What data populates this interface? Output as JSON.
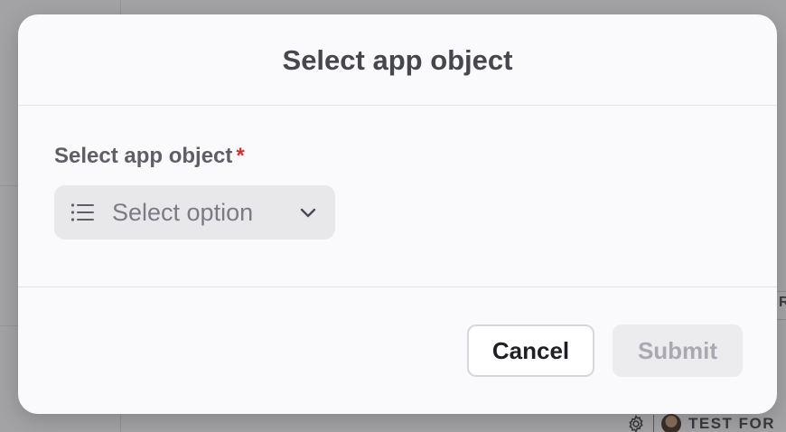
{
  "modal": {
    "title": "Select app object",
    "field": {
      "label": "Select app object",
      "required_mark": "*",
      "placeholder": "Select option"
    },
    "buttons": {
      "cancel": "Cancel",
      "submit": "Submit"
    }
  },
  "background": {
    "cell_letter": "R",
    "user_label": "TEST FOR"
  },
  "icons": {
    "field_icon": "list-icon",
    "dropdown_icon": "chevron-down-icon",
    "settings_icon": "gear-icon"
  },
  "colors": {
    "required": "#d32f2f",
    "overlay": "#a3a3a5",
    "modal_bg": "#fafafc"
  }
}
